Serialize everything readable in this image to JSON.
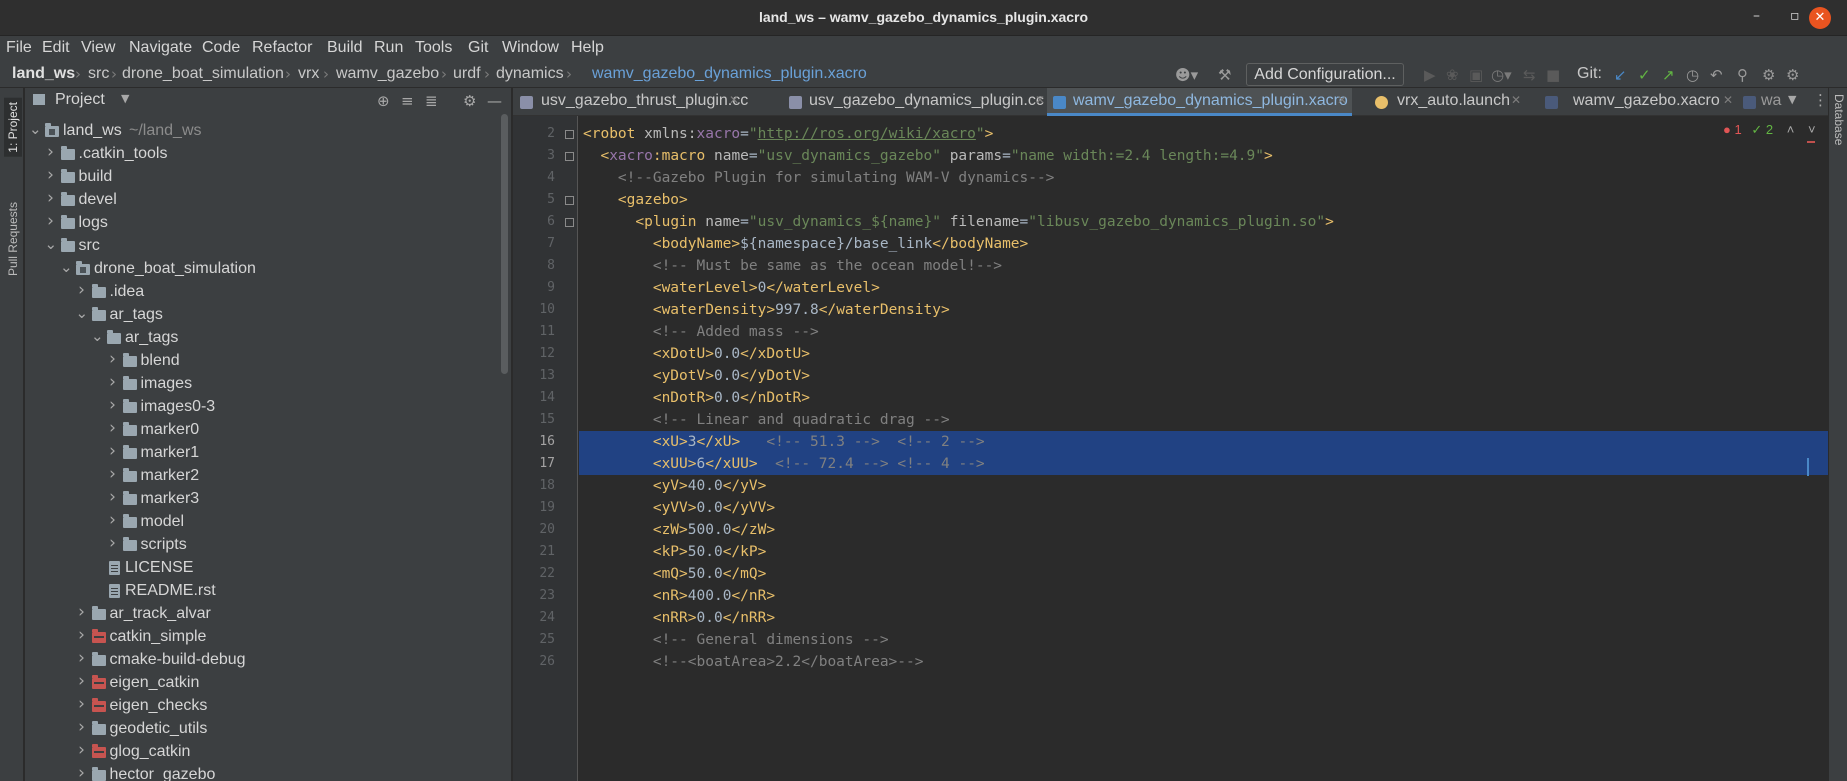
{
  "window": {
    "title": "land_ws – wamv_gazebo_dynamics_plugin.xacro",
    "minimize": "–",
    "maximize": "▫",
    "close": "✕"
  },
  "menu": [
    "File",
    "Edit",
    "View",
    "Navigate",
    "Code",
    "Refactor",
    "Build",
    "Run",
    "Tools",
    "Git",
    "Window",
    "Help"
  ],
  "breadcrumb": [
    "land_ws",
    "src",
    "drone_boat_simulation",
    "vrx",
    "wamv_gazebo",
    "urdf",
    "dynamics",
    "wamv_gazebo_dynamics_plugin.xacro"
  ],
  "toolbar": {
    "add_configuration": "Add Configuration...",
    "git_label": "Git:"
  },
  "left_tabs": [
    "1: Project",
    "Pull Requests"
  ],
  "right_tabs": [
    "Database"
  ],
  "project": {
    "title": "Project",
    "tree": [
      {
        "label": "land_ws",
        "hint": "~/land_ws",
        "depth": 0,
        "arrow": "open",
        "icon": "folder-module"
      },
      {
        "label": ".catkin_tools",
        "depth": 1,
        "arrow": "closed",
        "icon": "folder"
      },
      {
        "label": "build",
        "depth": 1,
        "arrow": "closed",
        "icon": "folder"
      },
      {
        "label": "devel",
        "depth": 1,
        "arrow": "closed",
        "icon": "folder"
      },
      {
        "label": "logs",
        "depth": 1,
        "arrow": "closed",
        "icon": "folder"
      },
      {
        "label": "src",
        "depth": 1,
        "arrow": "open",
        "icon": "folder"
      },
      {
        "label": "drone_boat_simulation",
        "depth": 2,
        "arrow": "open",
        "icon": "folder-module"
      },
      {
        "label": ".idea",
        "depth": 3,
        "arrow": "closed",
        "icon": "folder"
      },
      {
        "label": "ar_tags",
        "depth": 3,
        "arrow": "open",
        "icon": "folder"
      },
      {
        "label": "ar_tags",
        "depth": 4,
        "arrow": "open",
        "icon": "folder"
      },
      {
        "label": "blend",
        "depth": 5,
        "arrow": "closed",
        "icon": "folder"
      },
      {
        "label": "images",
        "depth": 5,
        "arrow": "closed",
        "icon": "folder"
      },
      {
        "label": "images0-3",
        "depth": 5,
        "arrow": "closed",
        "icon": "folder"
      },
      {
        "label": "marker0",
        "depth": 5,
        "arrow": "closed",
        "icon": "folder"
      },
      {
        "label": "marker1",
        "depth": 5,
        "arrow": "closed",
        "icon": "folder"
      },
      {
        "label": "marker2",
        "depth": 5,
        "arrow": "closed",
        "icon": "folder"
      },
      {
        "label": "marker3",
        "depth": 5,
        "arrow": "closed",
        "icon": "folder"
      },
      {
        "label": "model",
        "depth": 5,
        "arrow": "closed",
        "icon": "folder"
      },
      {
        "label": "scripts",
        "depth": 5,
        "arrow": "closed",
        "icon": "folder"
      },
      {
        "label": "LICENSE",
        "depth": 4,
        "arrow": "none",
        "icon": "file"
      },
      {
        "label": "README.rst",
        "depth": 4,
        "arrow": "none",
        "icon": "file"
      },
      {
        "label": "ar_track_alvar",
        "depth": 3,
        "arrow": "closed",
        "icon": "folder"
      },
      {
        "label": "catkin_simple",
        "depth": 3,
        "arrow": "closed",
        "icon": "folder-package"
      },
      {
        "label": "cmake-build-debug",
        "depth": 3,
        "arrow": "closed",
        "icon": "folder"
      },
      {
        "label": "eigen_catkin",
        "depth": 3,
        "arrow": "closed",
        "icon": "folder-package"
      },
      {
        "label": "eigen_checks",
        "depth": 3,
        "arrow": "closed",
        "icon": "folder-package"
      },
      {
        "label": "geodetic_utils",
        "depth": 3,
        "arrow": "closed",
        "icon": "folder"
      },
      {
        "label": "glog_catkin",
        "depth": 3,
        "arrow": "closed",
        "icon": "folder-package"
      },
      {
        "label": "hector_gazebo",
        "depth": 3,
        "arrow": "closed",
        "icon": "folder"
      }
    ]
  },
  "tabs": [
    {
      "label": "usv_gazebo_thrust_plugin.cc",
      "icon": "cpp-file-icon",
      "active": false
    },
    {
      "label": "usv_gazebo_dynamics_plugin.cc",
      "icon": "cpp-file-icon",
      "active": false
    },
    {
      "label": "wamv_gazebo_dynamics_plugin.xacro",
      "icon": "xml-file-icon",
      "active": true
    },
    {
      "label": "vrx_auto.launch",
      "icon": "ros-launch-icon",
      "active": false
    },
    {
      "label": "wamv_gazebo.xacro",
      "icon": "xml-file-icon",
      "active": false
    },
    {
      "label": "wa",
      "icon": "xml-file-icon",
      "active": false
    }
  ],
  "inspections": {
    "errors": "1",
    "warnings": "2"
  },
  "code_lines": [
    {
      "n": "2",
      "text": "<robot xmlns:xacro=\"http://ros.org/wiki/xacro\">"
    },
    {
      "n": "3",
      "text": "  <xacro:macro name=\"usv_dynamics_gazebo\" params=\"name width:=2.4 length:=4.9\">"
    },
    {
      "n": "4",
      "text": "    <!--Gazebo Plugin for simulating WAM-V dynamics-->"
    },
    {
      "n": "5",
      "text": "    <gazebo>"
    },
    {
      "n": "6",
      "text": "      <plugin name=\"usv_dynamics_${name}\" filename=\"libusv_gazebo_dynamics_plugin.so\">"
    },
    {
      "n": "7",
      "text": "        <bodyName>${namespace}/base_link</bodyName>"
    },
    {
      "n": "8",
      "text": "        <!-- Must be same as the ocean model!-->"
    },
    {
      "n": "9",
      "text": "        <waterLevel>0</waterLevel>"
    },
    {
      "n": "10",
      "text": "        <waterDensity>997.8</waterDensity>"
    },
    {
      "n": "11",
      "text": "        <!-- Added mass -->"
    },
    {
      "n": "12",
      "text": "        <xDotU>0.0</xDotU>"
    },
    {
      "n": "13",
      "text": "        <yDotV>0.0</yDotV>"
    },
    {
      "n": "14",
      "text": "        <nDotR>0.0</nDotR>"
    },
    {
      "n": "15",
      "text": "        <!-- Linear and quadratic drag -->"
    },
    {
      "n": "16",
      "text": "        <xU>3</xU>   <!-- 51.3 -->  <!-- 2 -->"
    },
    {
      "n": "17",
      "text": "        <xUU>6</xUU>  <!-- 72.4 --> <!-- 4 -->"
    },
    {
      "n": "18",
      "text": "        <yV>40.0</yV>"
    },
    {
      "n": "19",
      "text": "        <yVV>0.0</yVV>"
    },
    {
      "n": "20",
      "text": "        <zW>500.0</zW>"
    },
    {
      "n": "21",
      "text": "        <kP>50.0</kP>"
    },
    {
      "n": "22",
      "text": "        <mQ>50.0</mQ>"
    },
    {
      "n": "23",
      "text": "        <nR>400.0</nR>"
    },
    {
      "n": "24",
      "text": "        <nRR>0.0</nRR>"
    },
    {
      "n": "25",
      "text": "        <!-- General dimensions -->"
    },
    {
      "n": "26",
      "text": "        <!--<boatArea>2.2</boatArea>-->"
    }
  ],
  "selection": {
    "lines": [
      "16",
      "17"
    ]
  },
  "colors": {
    "accent": "#4a88c7",
    "selection": "#214283",
    "tag": "#e8bf6a",
    "string": "#6a8759",
    "comment": "#808080",
    "error": "#e05555",
    "ok": "#62b543"
  }
}
